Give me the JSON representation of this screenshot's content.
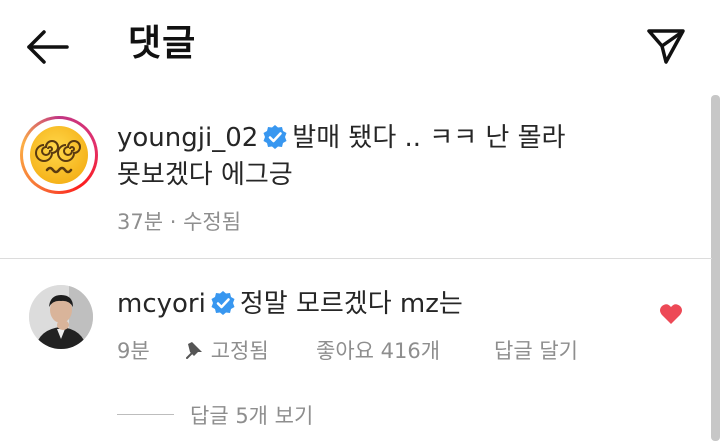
{
  "header": {
    "title": "댓글",
    "back_icon": "arrow-left-icon",
    "send_icon": "paper-plane-icon"
  },
  "comments": [
    {
      "username": "youngji_02",
      "verified": true,
      "text_line1": "발매 됐다 .. ㅋㅋ 난 몰라",
      "text_line2": "못보겠다 에그긍",
      "time": "37분",
      "separator": "·",
      "edited": "수정됨",
      "avatar": "dizzy-face-emoji"
    },
    {
      "username": "mcyori",
      "verified": true,
      "text": "정말 모르겠다 mz는",
      "time": "9분",
      "pinned_label": "고정됨",
      "likes": "좋아요 416개",
      "reply_label": "답글 달기",
      "liked": true,
      "view_replies": "답글 5개 보기"
    }
  ],
  "colors": {
    "verified_blue": "#3897f0",
    "heart_red": "#ed4956",
    "meta_gray": "#8e8e8e"
  }
}
